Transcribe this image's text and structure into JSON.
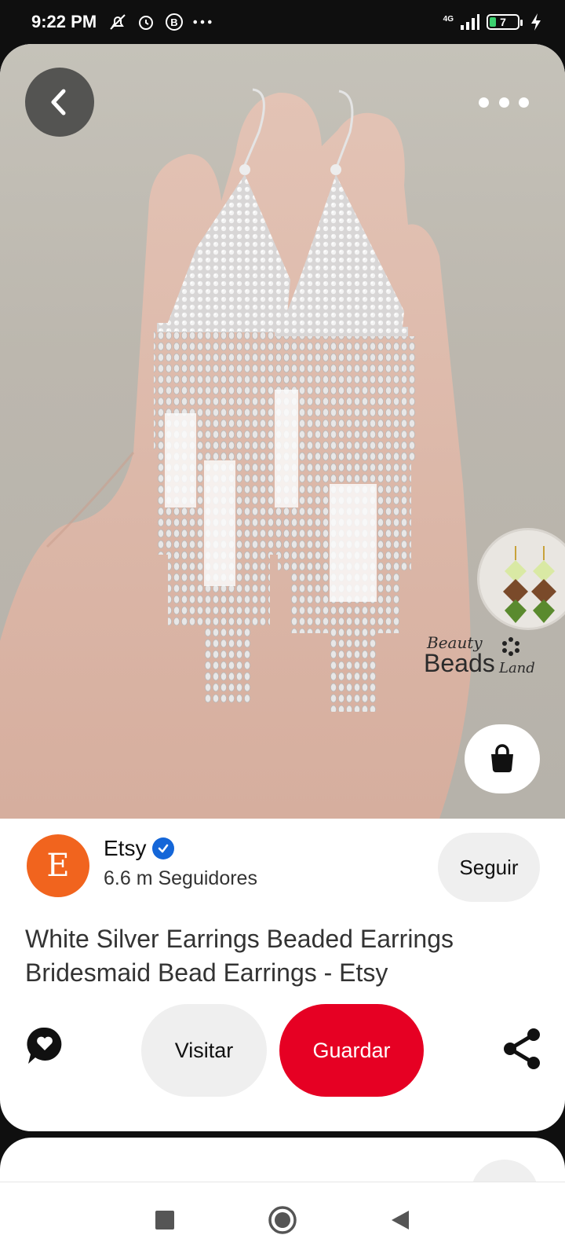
{
  "status_bar": {
    "time": "9:22 PM",
    "network": "4G",
    "battery_level": "7",
    "icons": [
      "notifications-off-icon",
      "alarm-icon",
      "b-badge-icon",
      "more-dots-icon",
      "signal-icon",
      "battery-icon",
      "charging-icon"
    ]
  },
  "hero": {
    "brand_top": "Beauty",
    "brand_main": "Beads",
    "brand_sub": "Land"
  },
  "creator": {
    "avatar_letter": "E",
    "name": "Etsy",
    "verified": true,
    "followers": "6.6 m Seguidores",
    "follow_label": "Seguir"
  },
  "pin": {
    "title": "White Silver Earrings Beaded Earrings Bridesmaid Bead Earrings - Etsy"
  },
  "actions": {
    "visit_label": "Visitar",
    "save_label": "Guardar"
  },
  "colors": {
    "save": "#e60023",
    "avatar": "#f1641e",
    "verified": "#1466d8"
  }
}
